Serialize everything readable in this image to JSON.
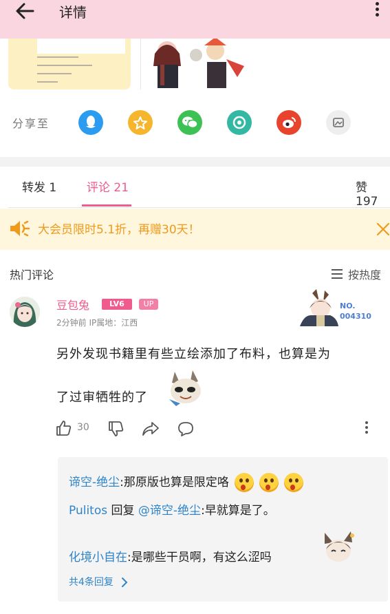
{
  "header": {
    "title": "详情"
  },
  "share": {
    "label": "分享至",
    "targets": [
      {
        "name": "qq",
        "color": "#2c9cf0"
      },
      {
        "name": "favorites",
        "color": "#f5b62e"
      },
      {
        "name": "wechat",
        "color": "#3ec154"
      },
      {
        "name": "moments",
        "color": "#33b8a4"
      },
      {
        "name": "weibo",
        "color": "#e8432d"
      },
      {
        "name": "gallery",
        "color": "#eeeeee"
      }
    ]
  },
  "tabs": {
    "repost": "转发 1",
    "comments": "评论 21",
    "likes": "赞 197"
  },
  "banner": {
    "text": "大会员限时5.1折，再赠30天！"
  },
  "section": {
    "title": "热门评论",
    "sort_label": "按热度"
  },
  "comment": {
    "username": "豆包兔",
    "level": "LV6",
    "up_badge": "UP",
    "meta": "2分钟前  IP属地：江西",
    "badge_no_label": "NO.",
    "badge_no_value": "004310",
    "content_line1": "另外发现书籍里有些立绘添加了布料，也算是为",
    "content_line2": "了过审牺牲的了",
    "like_count": "30"
  },
  "replies": [
    {
      "user": "谛空-绝尘",
      "sep": ":",
      "text": "那原版也算是限定咯"
    },
    {
      "user": "Pulitos",
      "mid": " 回复 ",
      "target": "@谛空-绝尘",
      "sep": ":",
      "text": "早就算是了。"
    },
    {
      "user": "化境小自在",
      "sep": ":",
      "text": "是哪些干员啊，有这么涩吗"
    }
  ],
  "replies_total": "共4条回复",
  "colors": {
    "accent": "#ee5b8c",
    "header_bg": "#fad6e0",
    "banner_text": "#f09a1b",
    "link": "#2e84c9"
  }
}
